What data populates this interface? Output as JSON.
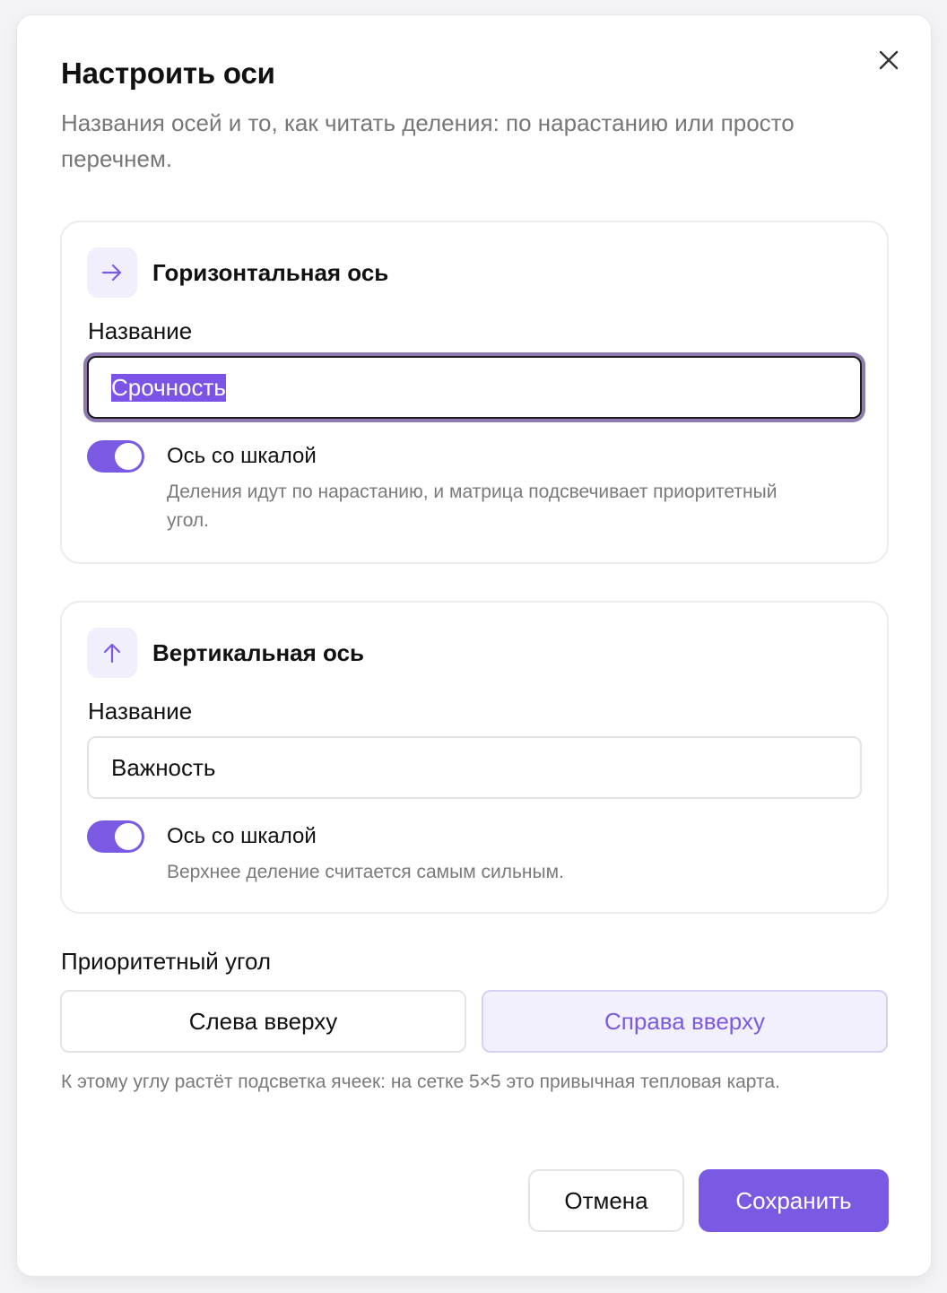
{
  "dialog": {
    "title": "Настроить оси",
    "subtitle": "Названия осей и то, как читать деления: по нарастанию или просто перечнем.",
    "close_icon": "close-icon"
  },
  "horizontal_axis": {
    "icon": "arrow-right-icon",
    "title": "Горизонтальная ось",
    "name_label": "Название",
    "name_value": "Срочность",
    "toggle_on": true,
    "toggle_label": "Ось со шкалой",
    "toggle_desc": "Деления идут по нарастанию, и матрица подсвечивает приоритетный угол."
  },
  "vertical_axis": {
    "icon": "arrow-up-icon",
    "title": "Вертикальная ось",
    "name_label": "Название",
    "name_value": "Важность",
    "toggle_on": true,
    "toggle_label": "Ось со шкалой",
    "toggle_desc": "Верхнее деление считается самым сильным."
  },
  "priority_corner": {
    "label": "Приоритетный угол",
    "options": [
      "Слева вверху",
      "Справа вверху"
    ],
    "selected": "Справа вверху",
    "hint": "К этому углу растёт подсветка ячеек: на сетке 5×5 это привычная тепловая карта."
  },
  "footer": {
    "cancel_label": "Отмена",
    "save_label": "Сохранить"
  },
  "colors": {
    "accent": "#7b5ae3",
    "accent_soft": "#f1effb",
    "muted_text": "#7a7a7a"
  }
}
